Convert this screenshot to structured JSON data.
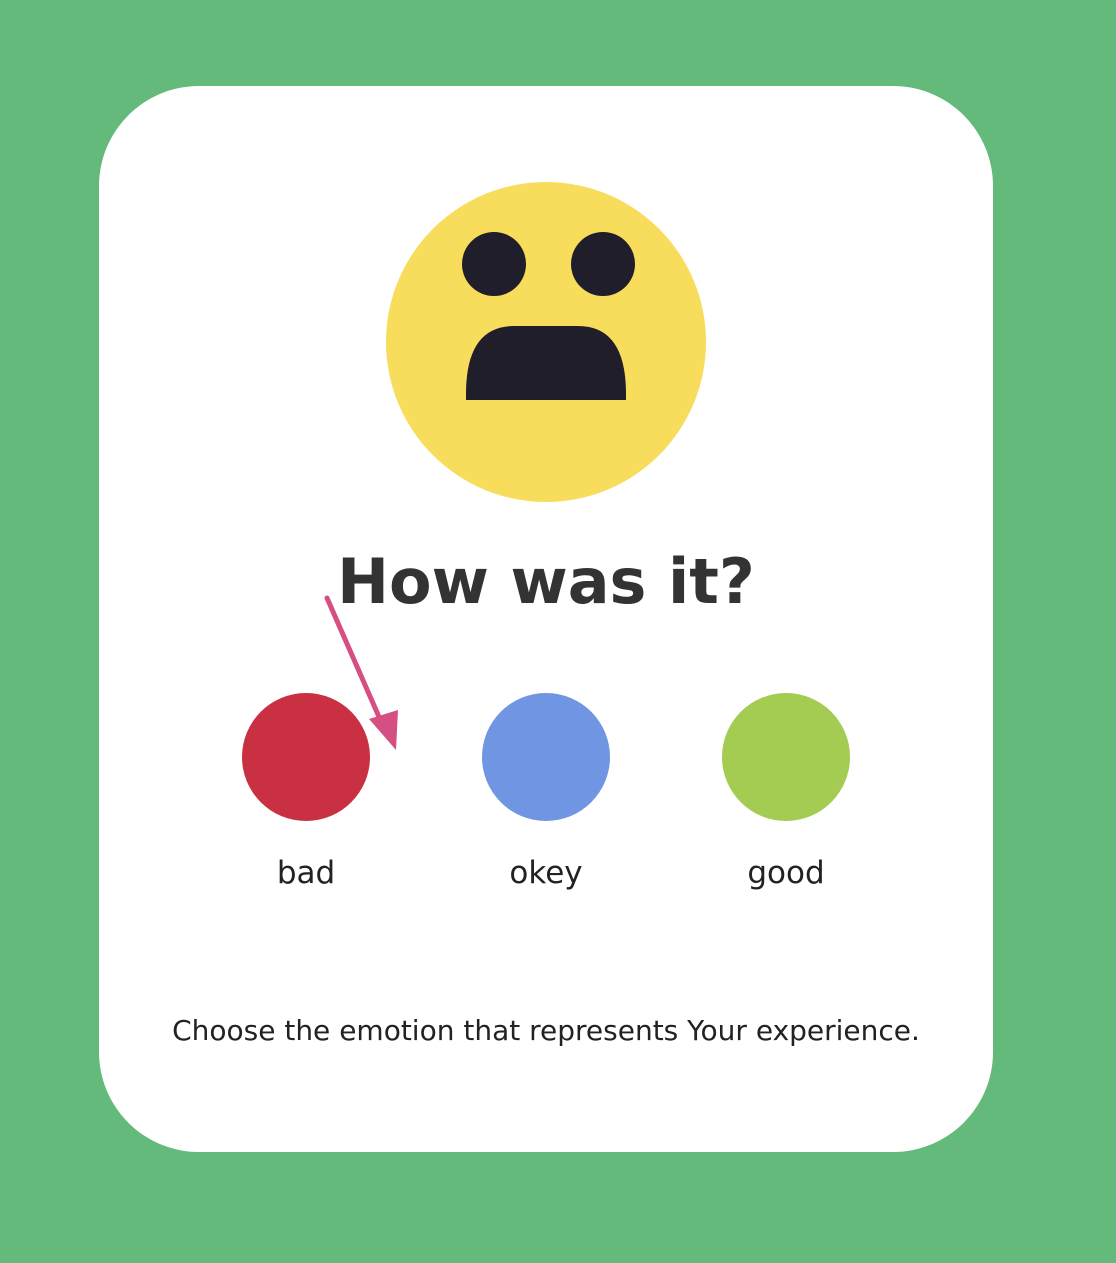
{
  "card": {
    "heading": "How was it?",
    "face_icon": "frightened-face-icon",
    "ratings": [
      {
        "label": "bad",
        "color": "#c93042"
      },
      {
        "label": "okey",
        "color": "#6f95e3"
      },
      {
        "label": "good",
        "color": "#a4cb52"
      }
    ],
    "instruction": "Choose the emotion that represents Your experience."
  },
  "colors": {
    "background": "#63ba7a",
    "card": "#ffffff",
    "face": "#f8dc5b",
    "face_features": "#201e2b",
    "arrow": "#d64f82",
    "heading": "#333333"
  },
  "annotation": {
    "icon": "arrow-down-icon",
    "target": "bad"
  }
}
